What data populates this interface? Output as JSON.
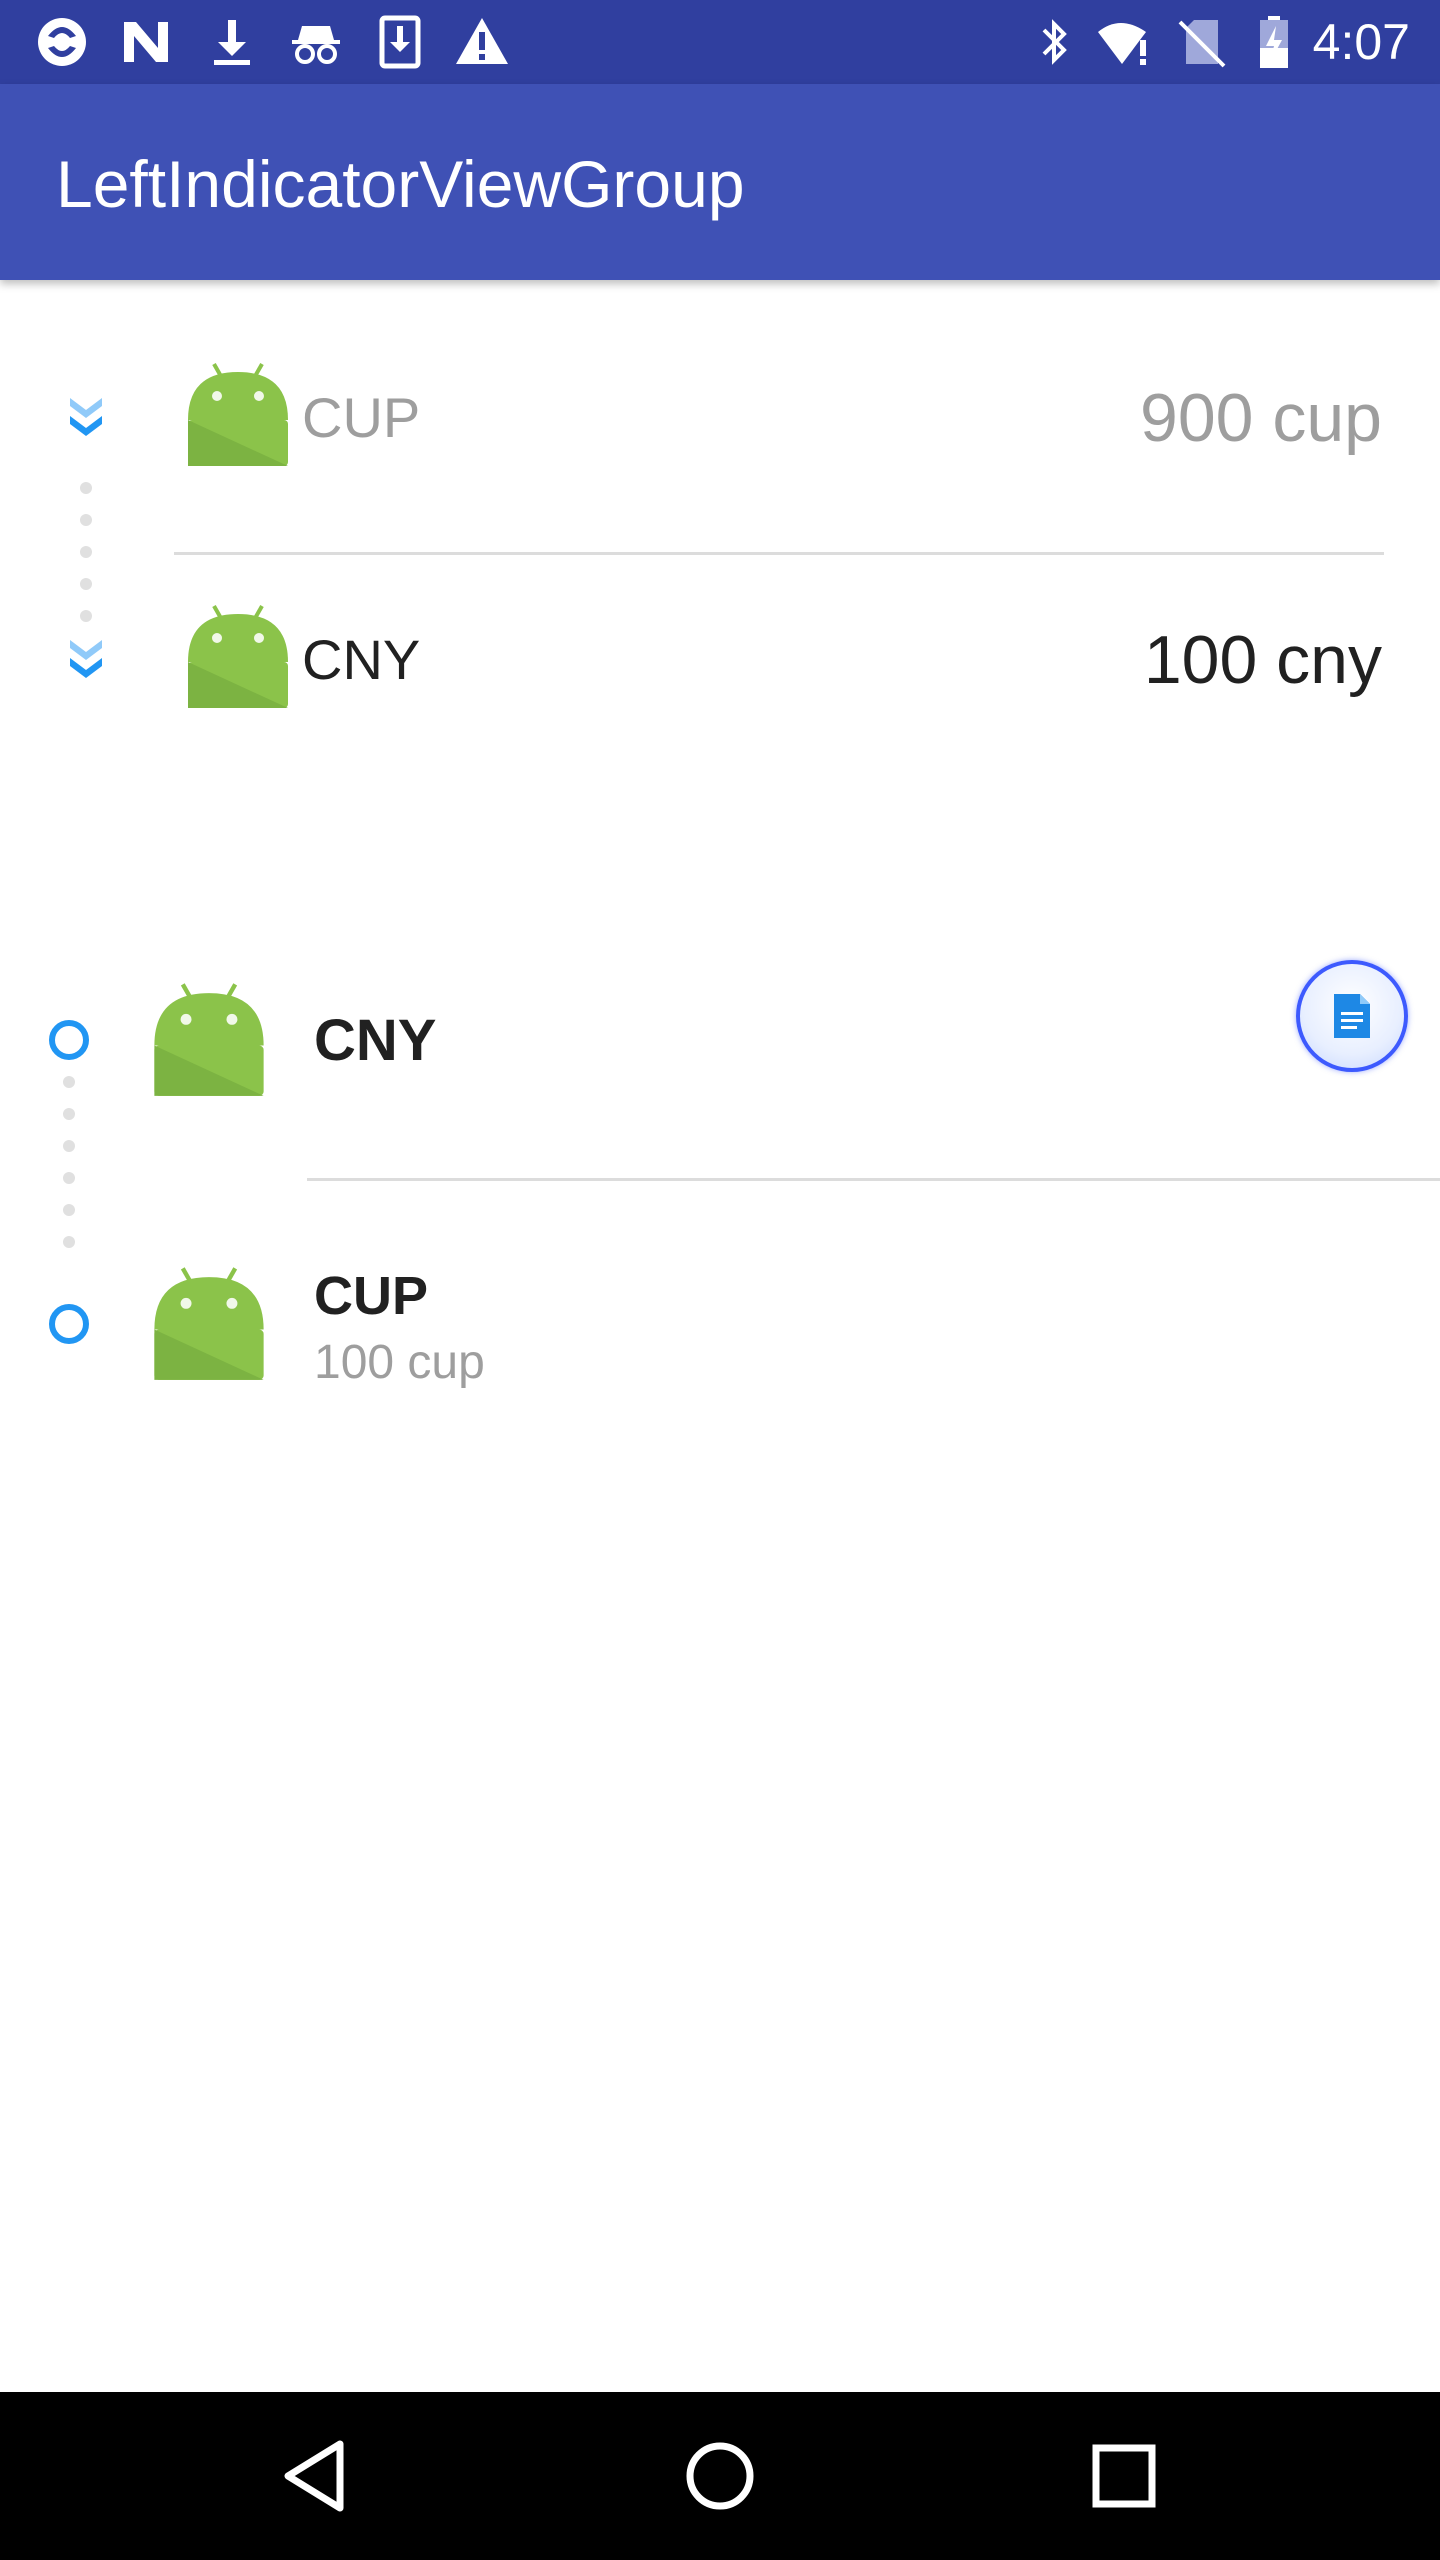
{
  "status_bar": {
    "time": "4:07",
    "left_icons": [
      "sync-icon",
      "n-icon",
      "download-icon",
      "incognito-icon",
      "download-box-icon",
      "warning-icon"
    ],
    "right_icons": [
      "bluetooth-icon",
      "wifi-alert-icon",
      "no-sim-icon",
      "battery-charging-icon"
    ]
  },
  "app_bar": {
    "title": "LeftIndicatorViewGroup"
  },
  "list_one": {
    "items": [
      {
        "name": "CUP",
        "amount": "900 cup"
      },
      {
        "name": "CNY",
        "amount": "100 cny"
      }
    ],
    "indicator_color": "#2196f3",
    "muted_text_color": "#9e9e9e"
  },
  "list_two": {
    "items": [
      {
        "name": "CNY",
        "amount": ""
      },
      {
        "name": "CUP",
        "amount": "100 cup"
      }
    ]
  },
  "fab": {
    "icon": "document-icon"
  },
  "nav_bar": {
    "buttons": [
      "back-icon",
      "home-icon",
      "recents-icon"
    ]
  }
}
